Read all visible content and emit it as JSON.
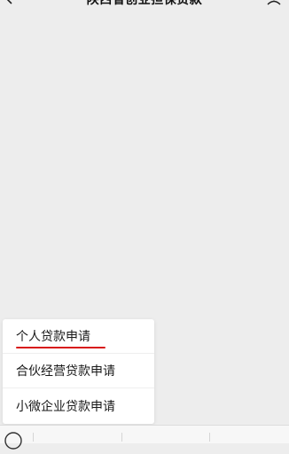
{
  "header": {
    "title": "陕西省创业担保贷款"
  },
  "menu": {
    "items": [
      {
        "label": "个人贷款申请",
        "underlined": true
      },
      {
        "label": "合伙经营贷款申请",
        "underlined": false
      },
      {
        "label": "小微企业贷款申请",
        "underlined": false
      }
    ]
  },
  "icons": {
    "back": "chevron-left-icon",
    "profile": "user-profile-icon",
    "keyboard": "keyboard-toggle-icon"
  },
  "colors": {
    "background": "#ededed",
    "menu_background": "#ffffff",
    "underline": "#d81818"
  }
}
